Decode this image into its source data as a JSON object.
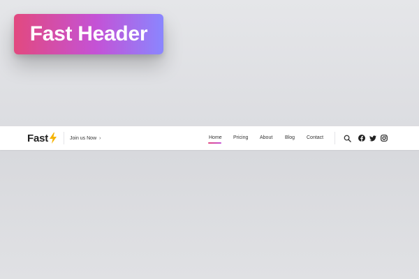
{
  "badge": {
    "title": "Fast Header"
  },
  "header": {
    "logo_text": "Fast",
    "cta_label": "Join us Now",
    "cta_arrow": "›",
    "nav": [
      {
        "label": "Home",
        "active": true
      },
      {
        "label": "Pricing",
        "active": false
      },
      {
        "label": "About",
        "active": false
      },
      {
        "label": "Blog",
        "active": false
      },
      {
        "label": "Contact",
        "active": false
      }
    ],
    "icons": [
      "search-icon",
      "facebook-icon",
      "twitter-icon",
      "instagram-icon"
    ]
  },
  "colors": {
    "badge_gradient_start": "#e2497f",
    "badge_gradient_end": "#8a86ff",
    "bolt": "#f5b300",
    "active_underline": "#e2497f"
  }
}
